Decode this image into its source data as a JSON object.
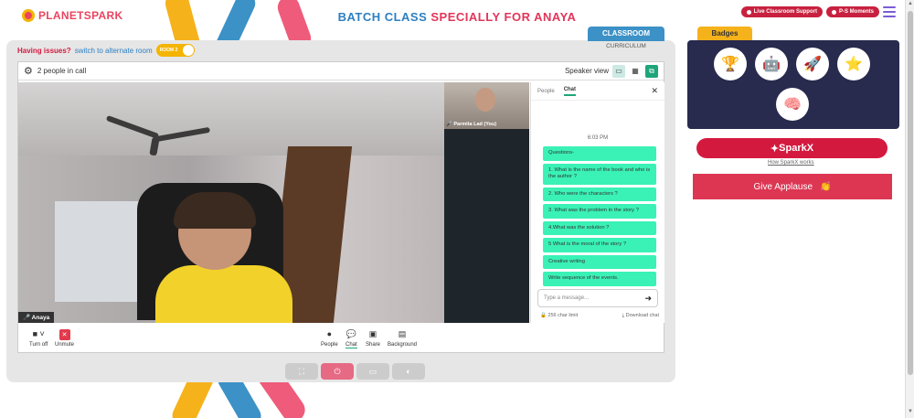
{
  "header": {
    "logo_text": "PLANETSPARK",
    "title_part1": "BATCH CLASS",
    "title_part2": "SPECIALLY FOR ANAYA",
    "live_support": "Live Classroom Support",
    "moments": "P-S Moments"
  },
  "tabs": {
    "classroom": "CLASSROOM",
    "curriculum": "CURRICULUM"
  },
  "issue": {
    "text": "Having issues?",
    "link": "switch to alternate room",
    "toggle_label": "ROOM 2"
  },
  "call": {
    "people_count": "2 people in call",
    "view_label": "Speaker view",
    "main_name": "Anaya",
    "side_name": "Parmita Lad (You)"
  },
  "chat": {
    "tab_people": "People",
    "tab_chat": "Chat",
    "time": "6:03 PM",
    "messages": [
      "Questions-",
      "1. What is the name of the book and who is the author ?",
      "2. Who were the characters ?",
      "3. What was the problem in the story ?",
      "4.What was the solution ?",
      "5 What is the moral of the story ?",
      "Creative writing",
      "Write sequence of the events."
    ],
    "placeholder": "Type a message...",
    "char_limit": "256 char limit",
    "download": "Download chat"
  },
  "controls": {
    "turn_off": "Turn off",
    "unmute": "Unmute",
    "people": "People",
    "chat": "Chat",
    "share": "Share",
    "background": "Background"
  },
  "badges": {
    "title": "Badges",
    "icons": [
      "trophy-badge-icon",
      "robot-badge-icon",
      "rocket-badge-icon",
      "star-badge-icon",
      "brain-badge-icon"
    ]
  },
  "sparkx": {
    "label": "SparkX",
    "link": "How SparkX works"
  },
  "applause": {
    "label": "Give Applause"
  },
  "colors": {
    "accent_red": "#d4193f",
    "accent_blue": "#2d7fc1",
    "chat_green": "#3af2b5",
    "badge_bg": "#282a4e"
  }
}
